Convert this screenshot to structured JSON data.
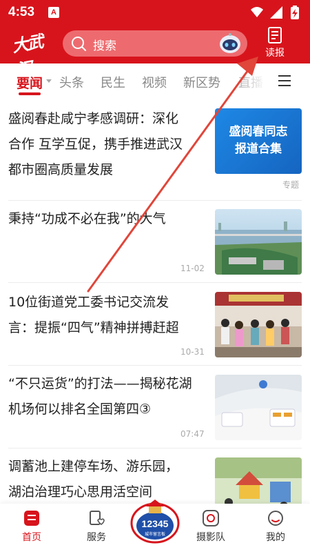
{
  "status": {
    "time": "4:53",
    "notification_icon": "A"
  },
  "header": {
    "logo_text": "大武汉",
    "search_placeholder": "搜索",
    "read_report_label": "读报",
    "brand_color": "#d7141c"
  },
  "tabs": [
    {
      "label": "要闻",
      "active": true
    },
    {
      "label": "头条"
    },
    {
      "label": "民生"
    },
    {
      "label": "视频"
    },
    {
      "label": "新区势"
    },
    {
      "label": "直播"
    }
  ],
  "articles": [
    {
      "headline_lines": [
        "盛阅春赴咸宁孝感调研：深化",
        "合作 互学互促，携手推进武汉",
        "都市圈高质量发展"
      ],
      "card_text_lines": [
        "盛阅春同志",
        "报道合集"
      ],
      "tag": "专题"
    },
    {
      "headline_lines": [
        "秉持“功成不必在我”的大气"
      ],
      "date": "11-02",
      "thumb": "river-city-aerial"
    },
    {
      "headline_lines": [
        "10位街道党工委书记交流发",
        "言：提振“四气”精神拼搏赶超"
      ],
      "date": "10-31",
      "thumb": "community-crowd"
    },
    {
      "headline_lines": [
        "“不只运货”的打法——揭秘花湖",
        "机场何以排名全国第四③"
      ],
      "date": "07:47",
      "thumb": "airport-interior"
    },
    {
      "headline_lines": [
        "调蓄池上建停车场、游乐园，",
        "湖泊治理巧心思用活空间"
      ],
      "thumb": "park-playground"
    }
  ],
  "bottom_nav": [
    {
      "label": "首页",
      "active": true
    },
    {
      "label": "服务"
    },
    {
      "label": "12345",
      "center": true,
      "sub": "城市留言板"
    },
    {
      "label": "摄影队"
    },
    {
      "label": "我的"
    }
  ]
}
